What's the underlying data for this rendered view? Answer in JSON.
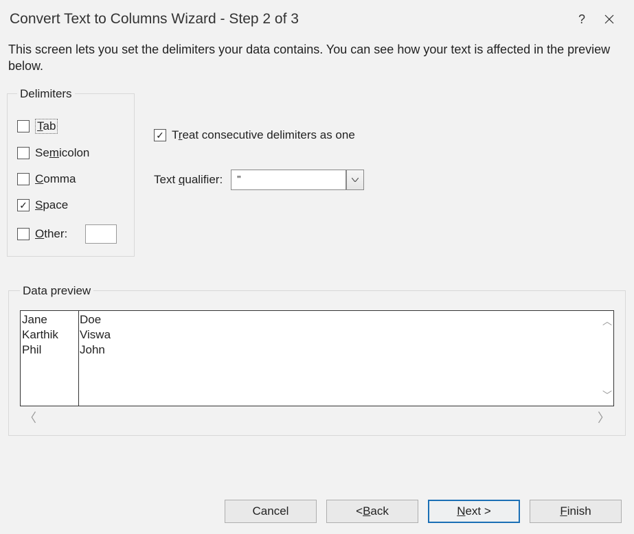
{
  "title": "Convert Text to Columns Wizard - Step 2 of 3",
  "description": "This screen lets you set the delimiters your data contains.  You can see how your text is affected in the preview below.",
  "delimiters": {
    "legend": "Delimiters",
    "tab": {
      "label": "Tab",
      "prefix": "T",
      "rest": "ab",
      "checked": false
    },
    "semicolon": {
      "label": "Semicolon",
      "prefix": "S",
      "rest": "emicolon",
      "mnemonic_pos": "none",
      "checked": false
    },
    "comma": {
      "label": "Comma",
      "prefix": "C",
      "rest": "omma",
      "checked": false
    },
    "space": {
      "label": "Space",
      "prefix": "S",
      "rest": "pace",
      "checked": true
    },
    "other": {
      "label": "Other:",
      "prefix": "O",
      "rest": "ther:",
      "checked": false,
      "value": ""
    }
  },
  "consecutive": {
    "pre": "T",
    "mid": "r",
    "post": "eat consecutive delimiters as one",
    "checked": true
  },
  "qualifier": {
    "label_pre": "Text ",
    "label_u": "q",
    "label_post": "ualifier:",
    "value": "\""
  },
  "preview": {
    "legend": "Data preview",
    "rows": [
      {
        "c1": "Jane",
        "c2": "Doe"
      },
      {
        "c1": "Karthik",
        "c2": "Viswa"
      },
      {
        "c1": "Phil",
        "c2": "John"
      }
    ]
  },
  "buttons": {
    "cancel": "Cancel",
    "back_pre": "< ",
    "back_u": "B",
    "back_post": "ack",
    "next_pre": "",
    "next_u": "N",
    "next_post": "ext >",
    "finish_pre": "",
    "finish_u": "F",
    "finish_post": "inish"
  }
}
